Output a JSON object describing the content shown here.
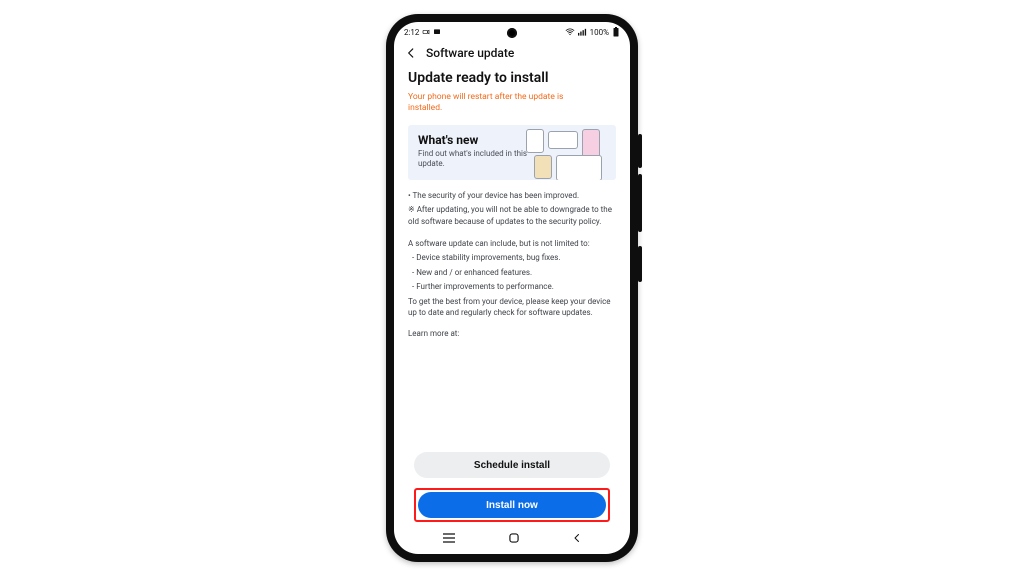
{
  "statusbar": {
    "time": "2:12",
    "battery_text": "100%"
  },
  "header": {
    "title": "Software update"
  },
  "page": {
    "title": "Update ready to install",
    "warning": "Your phone will restart after the update is installed."
  },
  "whatsnew": {
    "title": "What's new",
    "subtitle": "Find out what's included in this update."
  },
  "body": {
    "line1": "• The security of your device has been improved.",
    "line2": "※ After updating, you will not be able to downgrade to the old software because of updates to the security policy.",
    "intro": "A software update can include, but is not limited to:",
    "item1": "- Device stability improvements, bug fixes.",
    "item2": "- New and / or enhanced features.",
    "item3": "- Further improvements to performance.",
    "outro": "To get the best from your device, please keep your device up to date and regularly check for software updates.",
    "learn": "Learn more at:"
  },
  "buttons": {
    "schedule": "Schedule install",
    "install": "Install now"
  }
}
